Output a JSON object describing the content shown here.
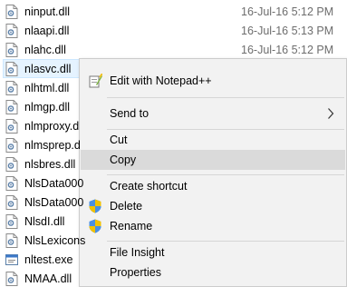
{
  "files": [
    {
      "name": "ninput.dll",
      "date": "16-Jul-16 5:12 PM",
      "icon": "dll-file-icon"
    },
    {
      "name": "nlaapi.dll",
      "date": "16-Jul-16 5:13 PM",
      "icon": "dll-file-icon"
    },
    {
      "name": "nlahc.dll",
      "date": "16-Jul-16 5:12 PM",
      "icon": "dll-file-icon"
    },
    {
      "name": "nlasvc.dll",
      "date": "",
      "icon": "dll-file-icon"
    },
    {
      "name": "nlhtml.dll",
      "date": "",
      "icon": "dll-file-icon"
    },
    {
      "name": "nlmgp.dll",
      "date": "",
      "icon": "dll-file-icon"
    },
    {
      "name": "nlmproxy.d",
      "date": "",
      "icon": "dll-file-icon"
    },
    {
      "name": "nlmsprep.d",
      "date": "",
      "icon": "dll-file-icon"
    },
    {
      "name": "nlsbres.dll",
      "date": "",
      "icon": "dll-file-icon"
    },
    {
      "name": "NlsData000",
      "date": "",
      "icon": "dll-file-icon"
    },
    {
      "name": "NlsData000",
      "date": "",
      "icon": "dll-file-icon"
    },
    {
      "name": "NlsdI.dll",
      "date": "",
      "icon": "dll-file-icon"
    },
    {
      "name": "NlsLexicons",
      "date": "",
      "icon": "dll-file-icon"
    },
    {
      "name": "nltest.exe",
      "date": "",
      "icon": "exe-file-icon"
    },
    {
      "name": "NMAA.dll",
      "date": "",
      "icon": "dll-file-icon"
    }
  ],
  "selected_file": "nlasvc.dll",
  "context_menu": {
    "edit_notepad": "Edit with Notepad++",
    "send_to": "Send to",
    "cut": "Cut",
    "copy": "Copy",
    "create_shortcut": "Create shortcut",
    "delete": "Delete",
    "rename": "Rename",
    "file_insight": "File Insight",
    "properties": "Properties",
    "highlighted": "Copy"
  },
  "colors": {
    "selection_bg": "#e5f3ff",
    "selection_border": "#cce8ff",
    "menu_bg": "#f2f2f2",
    "menu_highlight": "#dadada",
    "date_text": "#6d6d6d"
  }
}
